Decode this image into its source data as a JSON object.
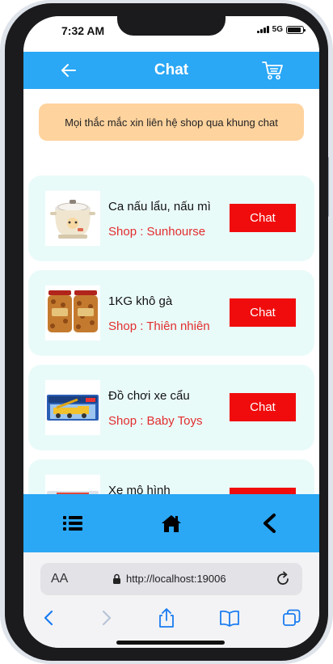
{
  "status_bar": {
    "time": "7:32 AM",
    "network": "5G",
    "battery_level": 0.9
  },
  "header": {
    "title": "Chat"
  },
  "notice": {
    "text": "Mọi thắc mắc xin liên hệ shop qua khung chat"
  },
  "products": [
    {
      "name": "Ca nấu lẩu, nấu mì",
      "shop": "Shop : Sunhourse",
      "chat_label": "Chat",
      "thumb_icon": "electric-pot-image"
    },
    {
      "name": "1KG khô gà",
      "shop": "Shop : Thiên nhiên",
      "chat_label": "Chat",
      "thumb_icon": "dried-chicken-jars-image"
    },
    {
      "name": "Đồ chơi xe cẩu",
      "shop": "Shop : Baby Toys",
      "chat_label": "Chat",
      "thumb_icon": "toy-crane-truck-image"
    },
    {
      "name": "Xe mô hình",
      "shop": "",
      "chat_label": "",
      "thumb_icon": "model-car-image"
    }
  ],
  "bottom_nav": {
    "items": [
      "list-icon",
      "home-icon",
      "chevron-left-icon"
    ]
  },
  "browser": {
    "aa_label": "AA",
    "url": "http://localhost:19006",
    "buttons": [
      "back-icon",
      "forward-icon",
      "share-icon",
      "bookmarks-icon",
      "tabs-icon"
    ]
  },
  "colors": {
    "header": "#2aa7f5",
    "notice": "#ffd39e",
    "card": "#e9fbf9",
    "chat_button": "#f00c0c",
    "shop_text": "#e22d2d"
  }
}
